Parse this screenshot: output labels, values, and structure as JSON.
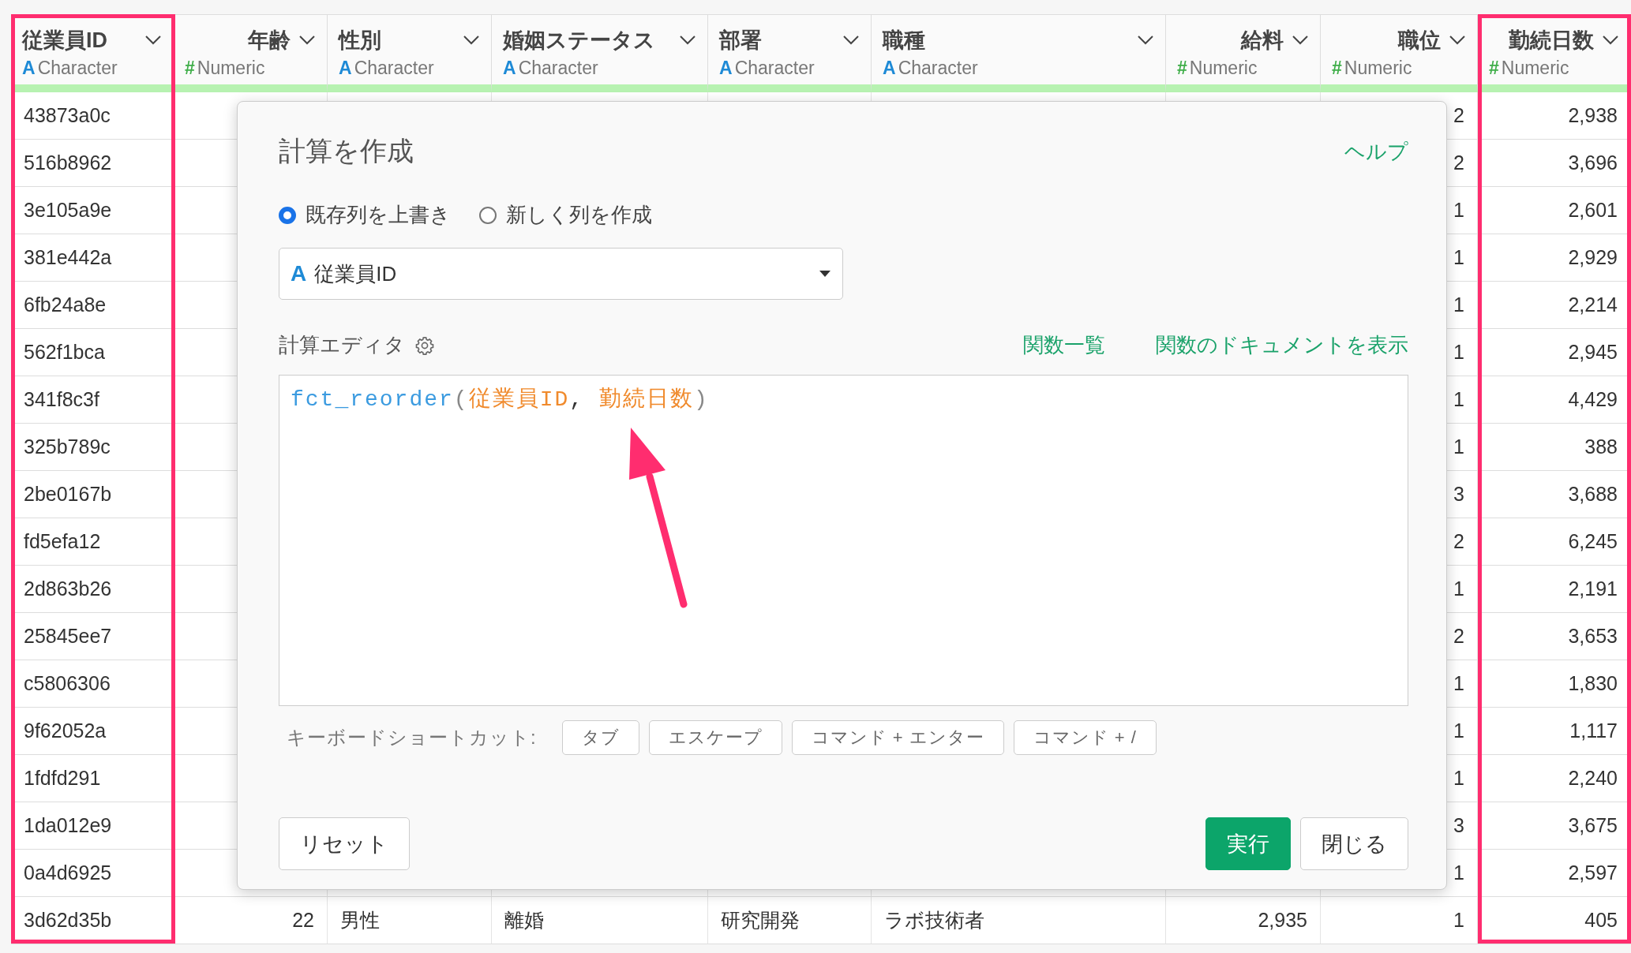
{
  "table": {
    "columns": [
      {
        "name": "従業員ID",
        "kind": "character",
        "type_icon": "A",
        "type": "Character",
        "highlighted": true
      },
      {
        "name": "年齢",
        "kind": "numeric",
        "type_icon": "#",
        "type": "Numeric",
        "highlighted": false
      },
      {
        "name": "性別",
        "kind": "character",
        "type_icon": "A",
        "type": "Character",
        "highlighted": false
      },
      {
        "name": "婚姻ステータス",
        "kind": "character",
        "type_icon": "A",
        "type": "Character",
        "highlighted": false
      },
      {
        "name": "部署",
        "kind": "character",
        "type_icon": "A",
        "type": "Character",
        "highlighted": false
      },
      {
        "name": "職種",
        "kind": "character",
        "type_icon": "A",
        "type": "Character",
        "highlighted": false
      },
      {
        "name": "給料",
        "kind": "numeric",
        "type_icon": "#",
        "type": "Numeric",
        "highlighted": false
      },
      {
        "name": "職位",
        "kind": "numeric",
        "type_icon": "#",
        "type": "Numeric",
        "highlighted": false
      },
      {
        "name": "勤続日数",
        "kind": "numeric",
        "type_icon": "#",
        "type": "Numeric",
        "highlighted": true
      }
    ],
    "rows": [
      {
        "employee_id": "43873a0c",
        "job_level": "2",
        "tenure_days": "2,938"
      },
      {
        "employee_id": "516b8962",
        "job_level": "2",
        "tenure_days": "3,696"
      },
      {
        "employee_id": "3e105a9e",
        "job_level": "1",
        "tenure_days": "2,601"
      },
      {
        "employee_id": "381e442a",
        "job_level": "1",
        "tenure_days": "2,929"
      },
      {
        "employee_id": "6fb24a8e",
        "job_level": "1",
        "tenure_days": "2,214"
      },
      {
        "employee_id": "562f1bca",
        "job_level": "1",
        "tenure_days": "2,945"
      },
      {
        "employee_id": "341f8c3f",
        "job_level": "1",
        "tenure_days": "4,429"
      },
      {
        "employee_id": "325b789c",
        "job_level": "1",
        "tenure_days": "388"
      },
      {
        "employee_id": "2be0167b",
        "job_level": "3",
        "tenure_days": "3,688"
      },
      {
        "employee_id": "fd5efa12",
        "job_level": "2",
        "tenure_days": "6,245"
      },
      {
        "employee_id": "2d863b26",
        "job_level": "1",
        "tenure_days": "2,191"
      },
      {
        "employee_id": "25845ee7",
        "job_level": "2",
        "tenure_days": "3,653"
      },
      {
        "employee_id": "c5806306",
        "job_level": "1",
        "tenure_days": "1,830"
      },
      {
        "employee_id": "9f62052a",
        "job_level": "1",
        "tenure_days": "1,117"
      },
      {
        "employee_id": "1fdfd291",
        "job_level": "1",
        "tenure_days": "2,240"
      },
      {
        "employee_id": "1da012e9",
        "job_level": "3",
        "tenure_days": "3,675"
      },
      {
        "employee_id": "0a4d6925",
        "job_level": "1",
        "tenure_days": "2,597"
      },
      {
        "employee_id": "3d62d35b",
        "age": "22",
        "gender": "男性",
        "marital_status": "離婚",
        "department": "研究開発",
        "job_role": "ラボ技術者",
        "salary": "2,935",
        "job_level": "1",
        "tenure_days": "405"
      }
    ]
  },
  "dialog": {
    "title": "計算を作成",
    "help_link": "ヘルプ",
    "radios": [
      {
        "label": "既存列を上書き",
        "selected": true
      },
      {
        "label": "新しく列を作成",
        "selected": false
      }
    ],
    "column_select": {
      "type_icon": "A",
      "value": "従業員ID"
    },
    "editor_label": "計算エディタ",
    "links": [
      "関数一覧",
      "関数のドキュメントを表示"
    ],
    "code": [
      {
        "text": "fct_reorder",
        "kind": "function"
      },
      {
        "text": "(",
        "kind": "punct"
      },
      {
        "text": "従業員ID",
        "kind": "column"
      },
      {
        "text": ", ",
        "kind": "plain"
      },
      {
        "text": "勤続日数",
        "kind": "column"
      },
      {
        "text": ")",
        "kind": "punct"
      }
    ],
    "shortcuts_label": "キーボードショートカット:",
    "shortcuts": [
      "タブ",
      "エスケープ",
      "コマンド + エンター",
      "コマンド + /"
    ],
    "buttons": [
      {
        "label": "リセット",
        "kind": "secondary"
      },
      {
        "label": "実行",
        "kind": "primary"
      },
      {
        "label": "閉じる",
        "kind": "secondary"
      }
    ]
  }
}
